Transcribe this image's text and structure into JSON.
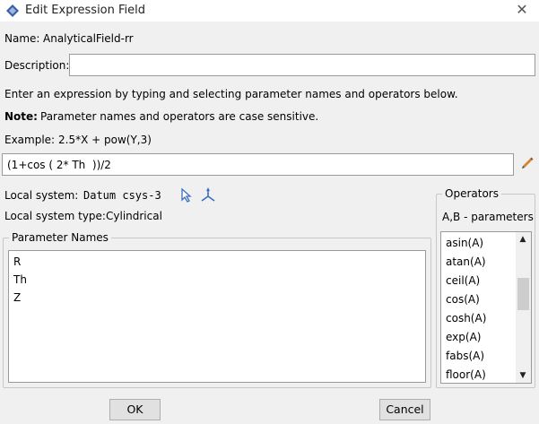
{
  "window": {
    "title": "Edit Expression Field",
    "close_glyph": "✕"
  },
  "name_label": "Name:",
  "name_value": "AnalyticalField-rr",
  "description_label": "Description:",
  "description_value": "",
  "instruction": "Enter an expression by typing and selecting parameter names and operators below.",
  "note_label": "Note:",
  "note_text": "Parameter names and operators are case sensitive.",
  "example_label": "Example:",
  "example_text": "2.5*X + pow(Y,3)",
  "expression_value": "(1+cos ( 2* Th  ))/2",
  "local_system_label": "Local system:",
  "local_system_value": "Datum csys-3",
  "local_system_type_label": "Local system type:",
  "local_system_type_value": "Cylindrical",
  "parameter_names": {
    "title": "Parameter Names",
    "items": [
      "R",
      "Th",
      "Z"
    ]
  },
  "operators": {
    "title": "Operators",
    "subtitle": "A,B - parameters",
    "items": [
      "asin(A)",
      "atan(A)",
      "ceil(A)",
      "cos(A)",
      "cosh(A)",
      "exp(A)",
      "fabs(A)",
      "floor(A)"
    ],
    "scroll_position": 0.35
  },
  "buttons": {
    "ok": "OK",
    "cancel": "Cancel"
  },
  "icons": {
    "app": "abaqus-app-icon",
    "edit": "pencil-icon",
    "select": "cursor-arrow-icon",
    "csys": "triad-axes-icon"
  },
  "colors": {
    "accent_blue": "#3a6fc4",
    "pencil_orange": "#d08a2e"
  }
}
